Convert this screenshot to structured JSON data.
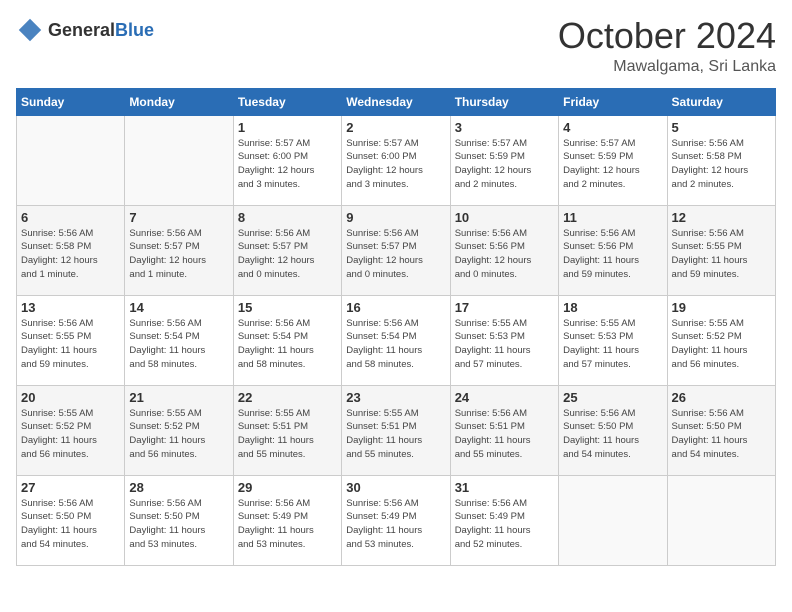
{
  "header": {
    "logo": {
      "general": "General",
      "blue": "Blue"
    },
    "title": "October 2024",
    "location": "Mawalgama, Sri Lanka"
  },
  "days_of_week": [
    "Sunday",
    "Monday",
    "Tuesday",
    "Wednesday",
    "Thursday",
    "Friday",
    "Saturday"
  ],
  "weeks": [
    [
      {
        "day": "",
        "info": ""
      },
      {
        "day": "",
        "info": ""
      },
      {
        "day": "1",
        "info": "Sunrise: 5:57 AM\nSunset: 6:00 PM\nDaylight: 12 hours\nand 3 minutes."
      },
      {
        "day": "2",
        "info": "Sunrise: 5:57 AM\nSunset: 6:00 PM\nDaylight: 12 hours\nand 3 minutes."
      },
      {
        "day": "3",
        "info": "Sunrise: 5:57 AM\nSunset: 5:59 PM\nDaylight: 12 hours\nand 2 minutes."
      },
      {
        "day": "4",
        "info": "Sunrise: 5:57 AM\nSunset: 5:59 PM\nDaylight: 12 hours\nand 2 minutes."
      },
      {
        "day": "5",
        "info": "Sunrise: 5:56 AM\nSunset: 5:58 PM\nDaylight: 12 hours\nand 2 minutes."
      }
    ],
    [
      {
        "day": "6",
        "info": "Sunrise: 5:56 AM\nSunset: 5:58 PM\nDaylight: 12 hours\nand 1 minute."
      },
      {
        "day": "7",
        "info": "Sunrise: 5:56 AM\nSunset: 5:57 PM\nDaylight: 12 hours\nand 1 minute."
      },
      {
        "day": "8",
        "info": "Sunrise: 5:56 AM\nSunset: 5:57 PM\nDaylight: 12 hours\nand 0 minutes."
      },
      {
        "day": "9",
        "info": "Sunrise: 5:56 AM\nSunset: 5:57 PM\nDaylight: 12 hours\nand 0 minutes."
      },
      {
        "day": "10",
        "info": "Sunrise: 5:56 AM\nSunset: 5:56 PM\nDaylight: 12 hours\nand 0 minutes."
      },
      {
        "day": "11",
        "info": "Sunrise: 5:56 AM\nSunset: 5:56 PM\nDaylight: 11 hours\nand 59 minutes."
      },
      {
        "day": "12",
        "info": "Sunrise: 5:56 AM\nSunset: 5:55 PM\nDaylight: 11 hours\nand 59 minutes."
      }
    ],
    [
      {
        "day": "13",
        "info": "Sunrise: 5:56 AM\nSunset: 5:55 PM\nDaylight: 11 hours\nand 59 minutes."
      },
      {
        "day": "14",
        "info": "Sunrise: 5:56 AM\nSunset: 5:54 PM\nDaylight: 11 hours\nand 58 minutes."
      },
      {
        "day": "15",
        "info": "Sunrise: 5:56 AM\nSunset: 5:54 PM\nDaylight: 11 hours\nand 58 minutes."
      },
      {
        "day": "16",
        "info": "Sunrise: 5:56 AM\nSunset: 5:54 PM\nDaylight: 11 hours\nand 58 minutes."
      },
      {
        "day": "17",
        "info": "Sunrise: 5:55 AM\nSunset: 5:53 PM\nDaylight: 11 hours\nand 57 minutes."
      },
      {
        "day": "18",
        "info": "Sunrise: 5:55 AM\nSunset: 5:53 PM\nDaylight: 11 hours\nand 57 minutes."
      },
      {
        "day": "19",
        "info": "Sunrise: 5:55 AM\nSunset: 5:52 PM\nDaylight: 11 hours\nand 56 minutes."
      }
    ],
    [
      {
        "day": "20",
        "info": "Sunrise: 5:55 AM\nSunset: 5:52 PM\nDaylight: 11 hours\nand 56 minutes."
      },
      {
        "day": "21",
        "info": "Sunrise: 5:55 AM\nSunset: 5:52 PM\nDaylight: 11 hours\nand 56 minutes."
      },
      {
        "day": "22",
        "info": "Sunrise: 5:55 AM\nSunset: 5:51 PM\nDaylight: 11 hours\nand 55 minutes."
      },
      {
        "day": "23",
        "info": "Sunrise: 5:55 AM\nSunset: 5:51 PM\nDaylight: 11 hours\nand 55 minutes."
      },
      {
        "day": "24",
        "info": "Sunrise: 5:56 AM\nSunset: 5:51 PM\nDaylight: 11 hours\nand 55 minutes."
      },
      {
        "day": "25",
        "info": "Sunrise: 5:56 AM\nSunset: 5:50 PM\nDaylight: 11 hours\nand 54 minutes."
      },
      {
        "day": "26",
        "info": "Sunrise: 5:56 AM\nSunset: 5:50 PM\nDaylight: 11 hours\nand 54 minutes."
      }
    ],
    [
      {
        "day": "27",
        "info": "Sunrise: 5:56 AM\nSunset: 5:50 PM\nDaylight: 11 hours\nand 54 minutes."
      },
      {
        "day": "28",
        "info": "Sunrise: 5:56 AM\nSunset: 5:50 PM\nDaylight: 11 hours\nand 53 minutes."
      },
      {
        "day": "29",
        "info": "Sunrise: 5:56 AM\nSunset: 5:49 PM\nDaylight: 11 hours\nand 53 minutes."
      },
      {
        "day": "30",
        "info": "Sunrise: 5:56 AM\nSunset: 5:49 PM\nDaylight: 11 hours\nand 53 minutes."
      },
      {
        "day": "31",
        "info": "Sunrise: 5:56 AM\nSunset: 5:49 PM\nDaylight: 11 hours\nand 52 minutes."
      },
      {
        "day": "",
        "info": ""
      },
      {
        "day": "",
        "info": ""
      }
    ]
  ]
}
